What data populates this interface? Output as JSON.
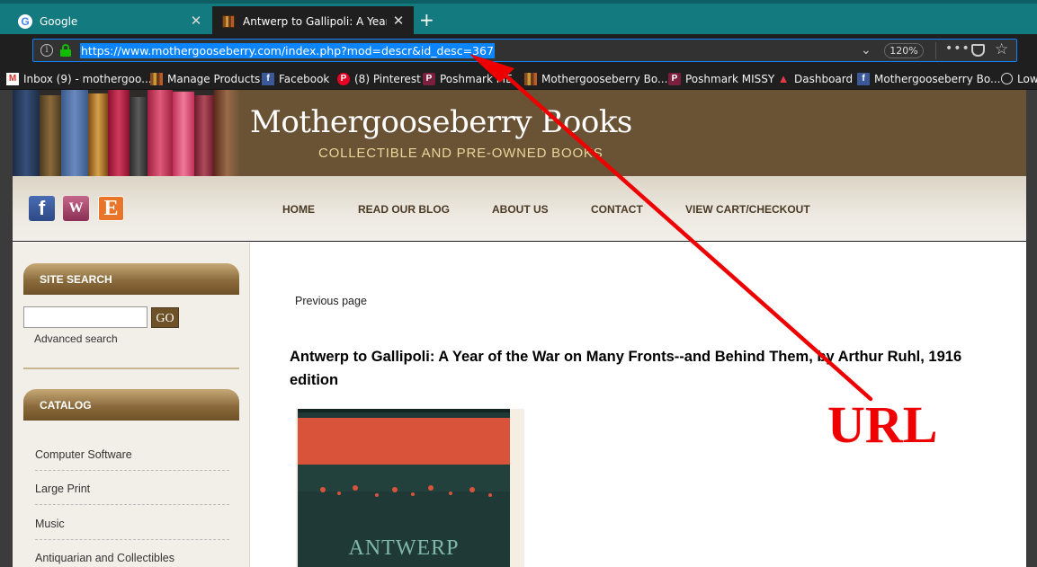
{
  "browser": {
    "tabs": [
      {
        "title": "Google",
        "favicon": "google-g-icon"
      },
      {
        "title": "Antwerp to Gallipoli: A Year of t",
        "favicon": "book-favicon-icon",
        "active": true
      }
    ],
    "url": "https://www.mothergooseberry.com/index.php?mod=descr&id_desc=367",
    "zoom": "120%",
    "colors": {
      "tabbar": "#137a7f",
      "chrome": "#1f1f1f",
      "url_highlight": "#0a84ff"
    }
  },
  "bookmarks": [
    {
      "label": "Inbox (9) - mothergoo...",
      "icon": "gmail-icon"
    },
    {
      "label": "Manage Products",
      "icon": "book-favicon-icon"
    },
    {
      "label": "Facebook",
      "icon": "facebook-icon"
    },
    {
      "label": "(8) Pinterest",
      "icon": "pinterest-icon"
    },
    {
      "label": "Poshmark ME",
      "icon": "poshmark-icon"
    },
    {
      "label": "Mothergooseberry Bo...",
      "icon": "book-favicon-icon"
    },
    {
      "label": "Poshmark MISSY",
      "icon": "poshmark-icon"
    },
    {
      "label": "Dashboard",
      "icon": "dashboard-icon"
    },
    {
      "label": "Mothergooseberry Bo...",
      "icon": "facebook-icon"
    },
    {
      "label": "Low",
      "icon": "globe-icon"
    }
  ],
  "site": {
    "title": "Mothergooseberry Books",
    "subtitle": "COLLECTIBLE AND PRE-OWNED BOOKS",
    "menu": [
      "HOME",
      "READ OUR BLOG",
      "ABOUT US",
      "CONTACT",
      "VIEW CART/CHECKOUT"
    ],
    "social": [
      "facebook-icon",
      "wordpress-icon",
      "etsy-icon"
    ],
    "social_letters": {
      "facebook": "f",
      "wordpress": "W",
      "etsy": "E"
    }
  },
  "sidebar": {
    "search_heading": "SITE SEARCH",
    "search_button": "GO",
    "advanced_search": "Advanced search",
    "catalog_heading": "CATALOG",
    "catalog_items": [
      "Computer Software",
      "Large Print",
      "Music",
      "Antiquarian and Collectibles"
    ]
  },
  "content": {
    "previous_page": "Previous page",
    "book_title": "Antwerp to Gallipoli: A Year of the War on Many Fronts--and Behind Them, by Arthur Ruhl, 1916 edition",
    "cover_text": "ANTWERP"
  },
  "annotation": {
    "label": "URL",
    "color": "#ee0000"
  }
}
